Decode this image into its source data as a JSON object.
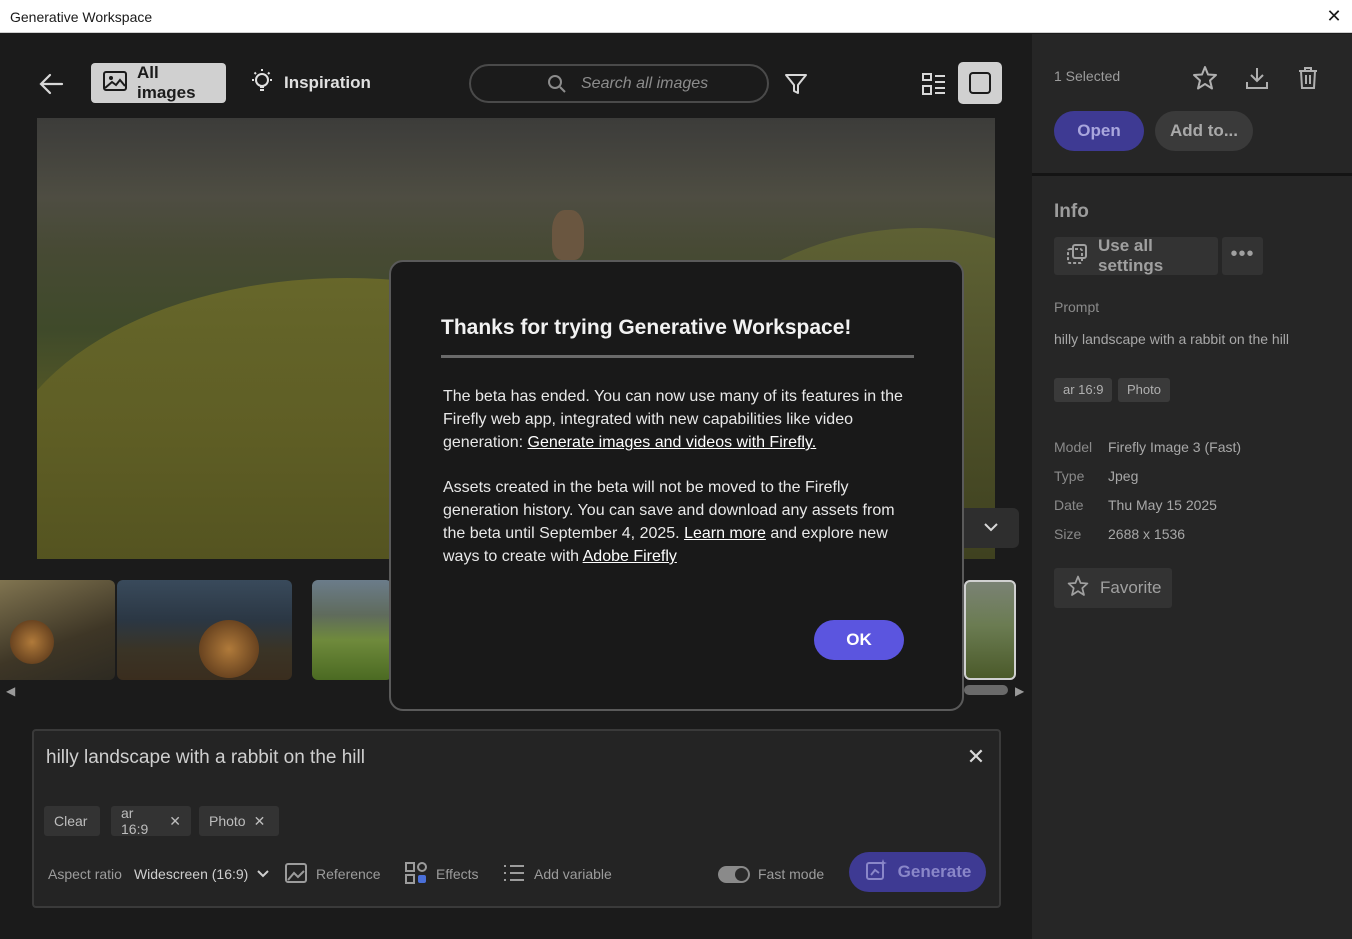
{
  "window": {
    "title": "Generative Workspace",
    "close_glyph": "✕"
  },
  "toolbar": {
    "tab_all": "All images",
    "tab_inspiration": "Inspiration",
    "search_placeholder": "Search all images"
  },
  "prompt_panel": {
    "prompt": "hilly landscape with a rabbit on the hill",
    "chips": {
      "clear": "Clear",
      "ar": "ar 16:9",
      "photo": "Photo"
    },
    "aspect_label": "Aspect ratio",
    "aspect_value": "Widescreen (16:9)",
    "reference": "Reference",
    "effects": "Effects",
    "add_variable": "Add variable",
    "fast_mode": "Fast mode",
    "fast_mode_on": true,
    "generate": "Generate"
  },
  "sidebar": {
    "selected": "1 Selected",
    "open": "Open",
    "add_to": "Add to...",
    "info_title": "Info",
    "use_all_settings": "Use all settings",
    "more": "•••",
    "prompt_label": "Prompt",
    "prompt_value": "hilly landscape with a rabbit on the hill",
    "tags": [
      "ar 16:9",
      "Photo"
    ],
    "meta": {
      "model_label": "Model",
      "model": "Firefly Image 3 (Fast)",
      "type_label": "Type",
      "type": "Jpeg",
      "date_label": "Date",
      "date": "Thu May 15 2025",
      "size_label": "Size",
      "size": "2688 x 1536"
    },
    "favorite": "Favorite"
  },
  "dialog": {
    "title": "Thanks for trying Generative Workspace!",
    "p1_text": "The beta has ended. You can now use many of its features in the Firefly web app, integrated with new capabilities like video generation: ",
    "p1_link": "Generate images and videos with Firefly.",
    "p2_text_a": "Assets created in the beta will not be moved to the Firefly generation history. You can save and download any assets from the beta until September 4, 2025. ",
    "p2_link_a": "Learn more",
    "p2_text_b": " and explore new ways to create with ",
    "p2_link_b": "Adobe Firefly",
    "ok": "OK"
  },
  "colors": {
    "accent": "#5b55df",
    "accent_dim": "#3e3a93",
    "background": "#1b1b1b",
    "sidebar": "#262626"
  }
}
